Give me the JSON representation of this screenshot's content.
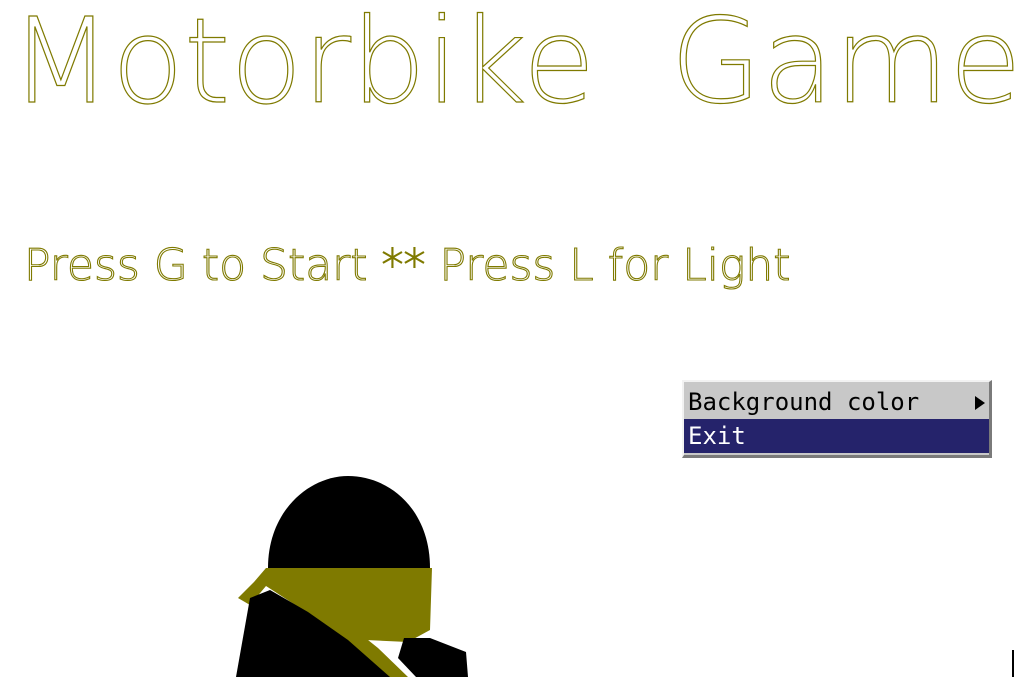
{
  "game": {
    "title": "Motorbike  Game",
    "instructions": "Press G to Start ** Press L for Light",
    "text_color": "#7f7a00"
  },
  "context_menu": {
    "items": [
      {
        "label": "Background color",
        "has_submenu": true,
        "highlighted": false
      },
      {
        "label": "Exit",
        "has_submenu": false,
        "highlighted": true
      }
    ],
    "highlight_color": "#25236b",
    "background_color": "#c8c8c8"
  },
  "scene": {
    "rider": {
      "helmet_color": "#000000",
      "scarf_color": "#7f7a00",
      "body_color": "#000000"
    }
  }
}
